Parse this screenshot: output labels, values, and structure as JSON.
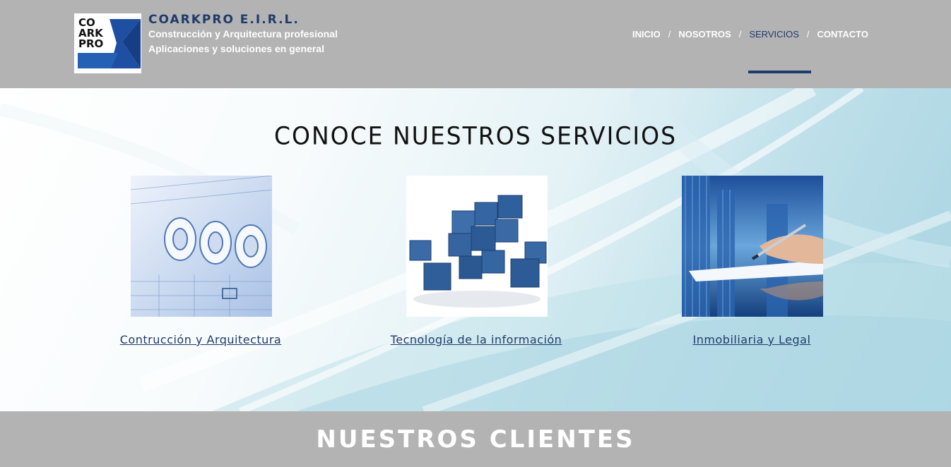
{
  "header": {
    "logo_text": [
      "CO",
      "ARK",
      "PRO"
    ],
    "company_name": "COARKPRO E.I.R.L.",
    "tagline_1": "Construcción y Arquitectura profesional",
    "tagline_2": "Aplicaciones y soluciones en general"
  },
  "nav": {
    "items": [
      {
        "label": "INICIO",
        "active": false
      },
      {
        "label": "NOSOTROS",
        "active": false
      },
      {
        "label": "SERVICIOS",
        "active": true
      },
      {
        "label": "CONTACTO",
        "active": false
      }
    ],
    "separator": "/"
  },
  "services": {
    "title": "CONOCE NUESTROS SERVICIOS",
    "cards": [
      {
        "label": "Contrucción y Arquitectura",
        "image": "blueprints-image"
      },
      {
        "label": "Tecnología de la información",
        "image": "blue-cubes-image"
      },
      {
        "label": "Inmobiliaria y Legal",
        "image": "business-signing-image"
      }
    ]
  },
  "clients": {
    "title": "NUESTROS CLIENTES"
  },
  "colors": {
    "header_bg": "#b3b3b3",
    "brand_blue": "#1f3b6b",
    "logo_blue": "#2461b5"
  }
}
